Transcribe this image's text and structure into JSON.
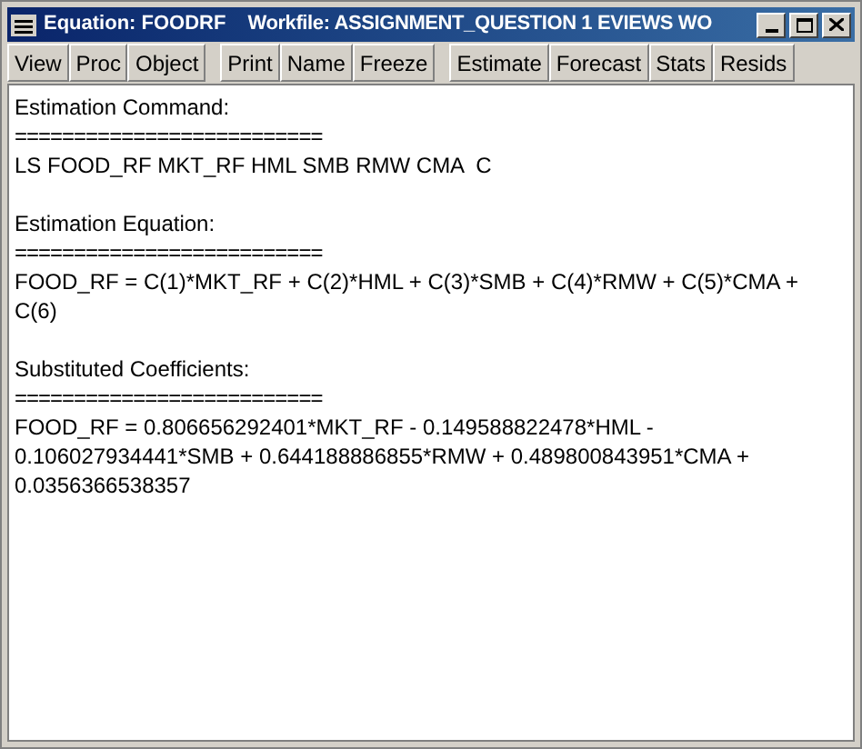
{
  "window": {
    "title": "Equation: FOODRF",
    "workfile": "Workfile: ASSIGNMENT_QUESTION 1 EVIEWS WO"
  },
  "toolbar": [
    [
      "View",
      "Proc",
      "Object"
    ],
    [
      "Print",
      "Name",
      "Freeze"
    ],
    [
      "Estimate",
      "Forecast",
      "Stats",
      "Resids"
    ]
  ],
  "sections": [
    {
      "heading": "Estimation Command:",
      "rule": "==========================",
      "lines": [
        "LS FOOD_RF MKT_RF HML SMB RMW CMA  C"
      ]
    },
    {
      "heading": "Estimation Equation:",
      "rule": "==========================",
      "lines": [
        "FOOD_RF = C(1)*MKT_RF + C(2)*HML + C(3)*SMB + C(4)*RMW + C(5)*CMA +",
        "C(6)"
      ]
    },
    {
      "heading": "Substituted Coefficients:",
      "rule": "==========================",
      "lines": [
        "FOOD_RF = 0.806656292401*MKT_RF - 0.149588822478*HML -",
        "0.106027934441*SMB + 0.644188886855*RMW + 0.489800843951*CMA +",
        "0.0356366538357"
      ]
    }
  ]
}
